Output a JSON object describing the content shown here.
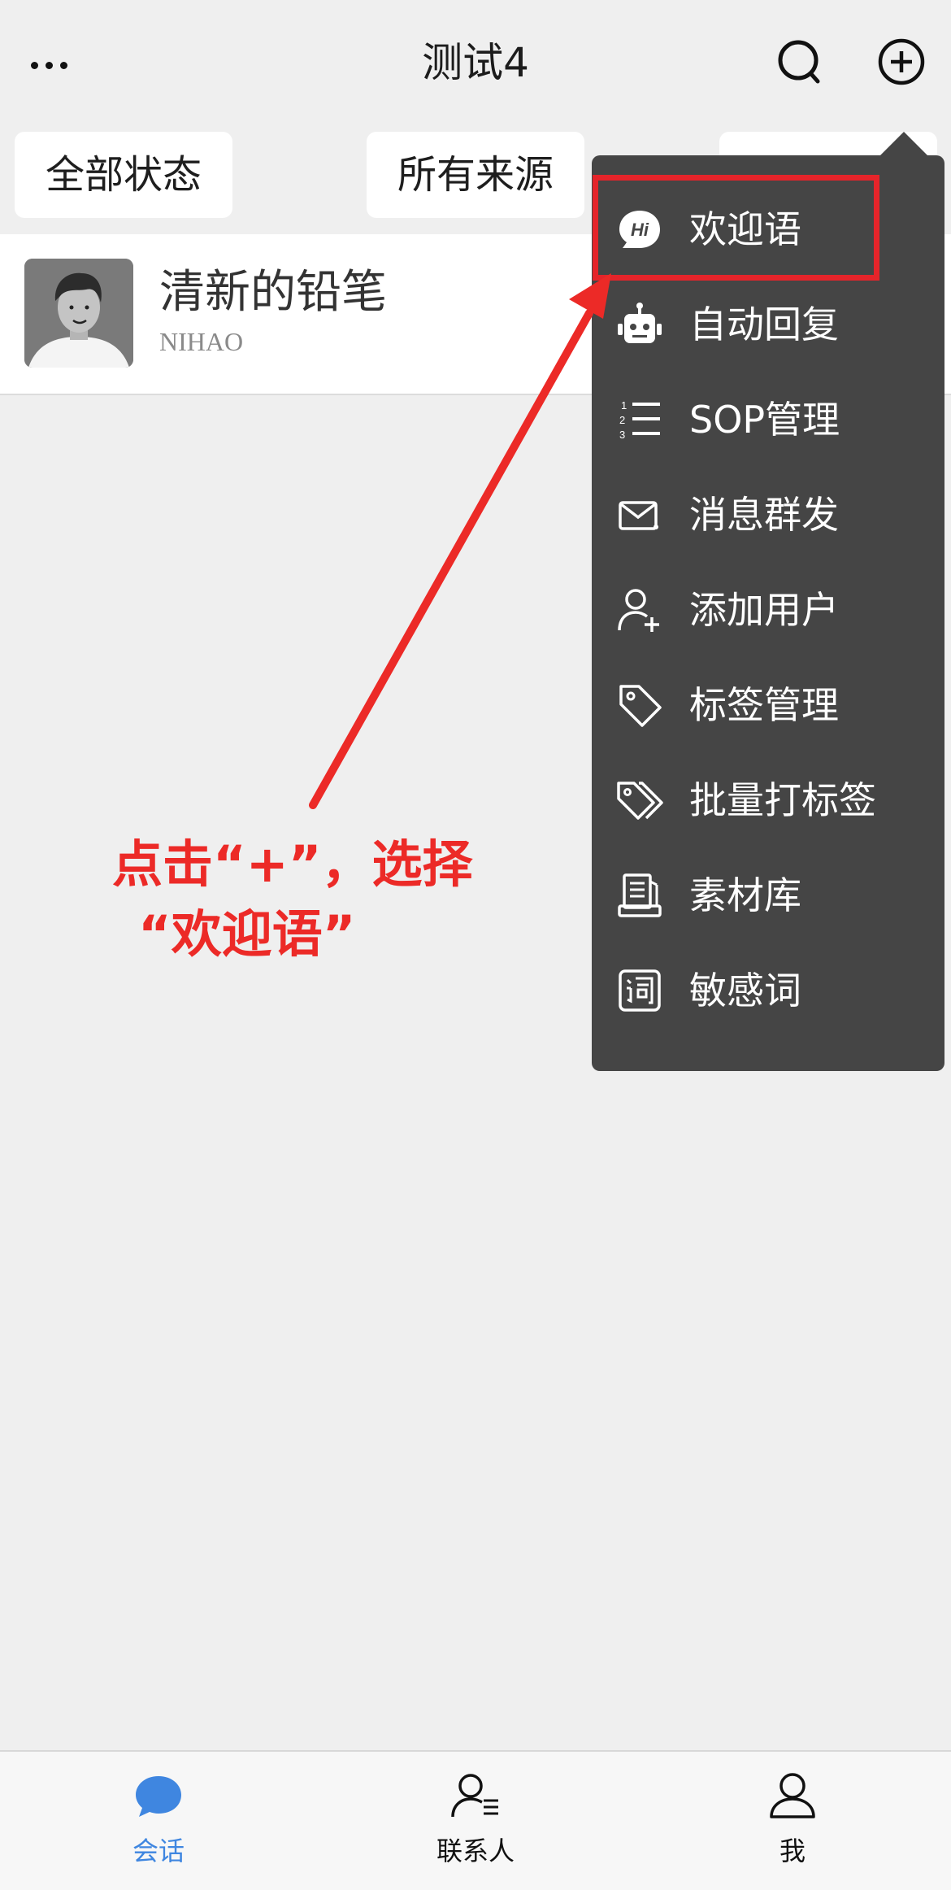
{
  "header": {
    "title": "测试4"
  },
  "filters": [
    {
      "label": "全部状态"
    },
    {
      "label": "所有来源"
    }
  ],
  "chat": {
    "name": "清新的铅笔",
    "subtitle": "NIHAO"
  },
  "menu": {
    "items": [
      {
        "label": "欢迎语",
        "icon": "hi-bubble-icon"
      },
      {
        "label": "自动回复",
        "icon": "robot-icon"
      },
      {
        "label": "SOP管理",
        "icon": "numbered-list-icon"
      },
      {
        "label": "消息群发",
        "icon": "mail-icon"
      },
      {
        "label": "添加用户",
        "icon": "add-user-icon"
      },
      {
        "label": "标签管理",
        "icon": "tag-icon"
      },
      {
        "label": "批量打标签",
        "icon": "multi-tag-icon"
      },
      {
        "label": "素材库",
        "icon": "library-icon"
      },
      {
        "label": "敏感词",
        "icon": "word-box-icon"
      }
    ]
  },
  "annotation": {
    "line1": "点击“+”，选择",
    "line2": "“欢迎语”",
    "color": "#ec2a27"
  },
  "tabs": [
    {
      "label": "会话",
      "icon": "chat-bubble-icon",
      "active": true
    },
    {
      "label": "联系人",
      "icon": "contacts-icon",
      "active": false
    },
    {
      "label": "我",
      "icon": "person-icon",
      "active": false
    }
  ],
  "colors": {
    "accent": "#3f86e0",
    "menu_bg": "#454545",
    "highlight": "#e5242a"
  }
}
